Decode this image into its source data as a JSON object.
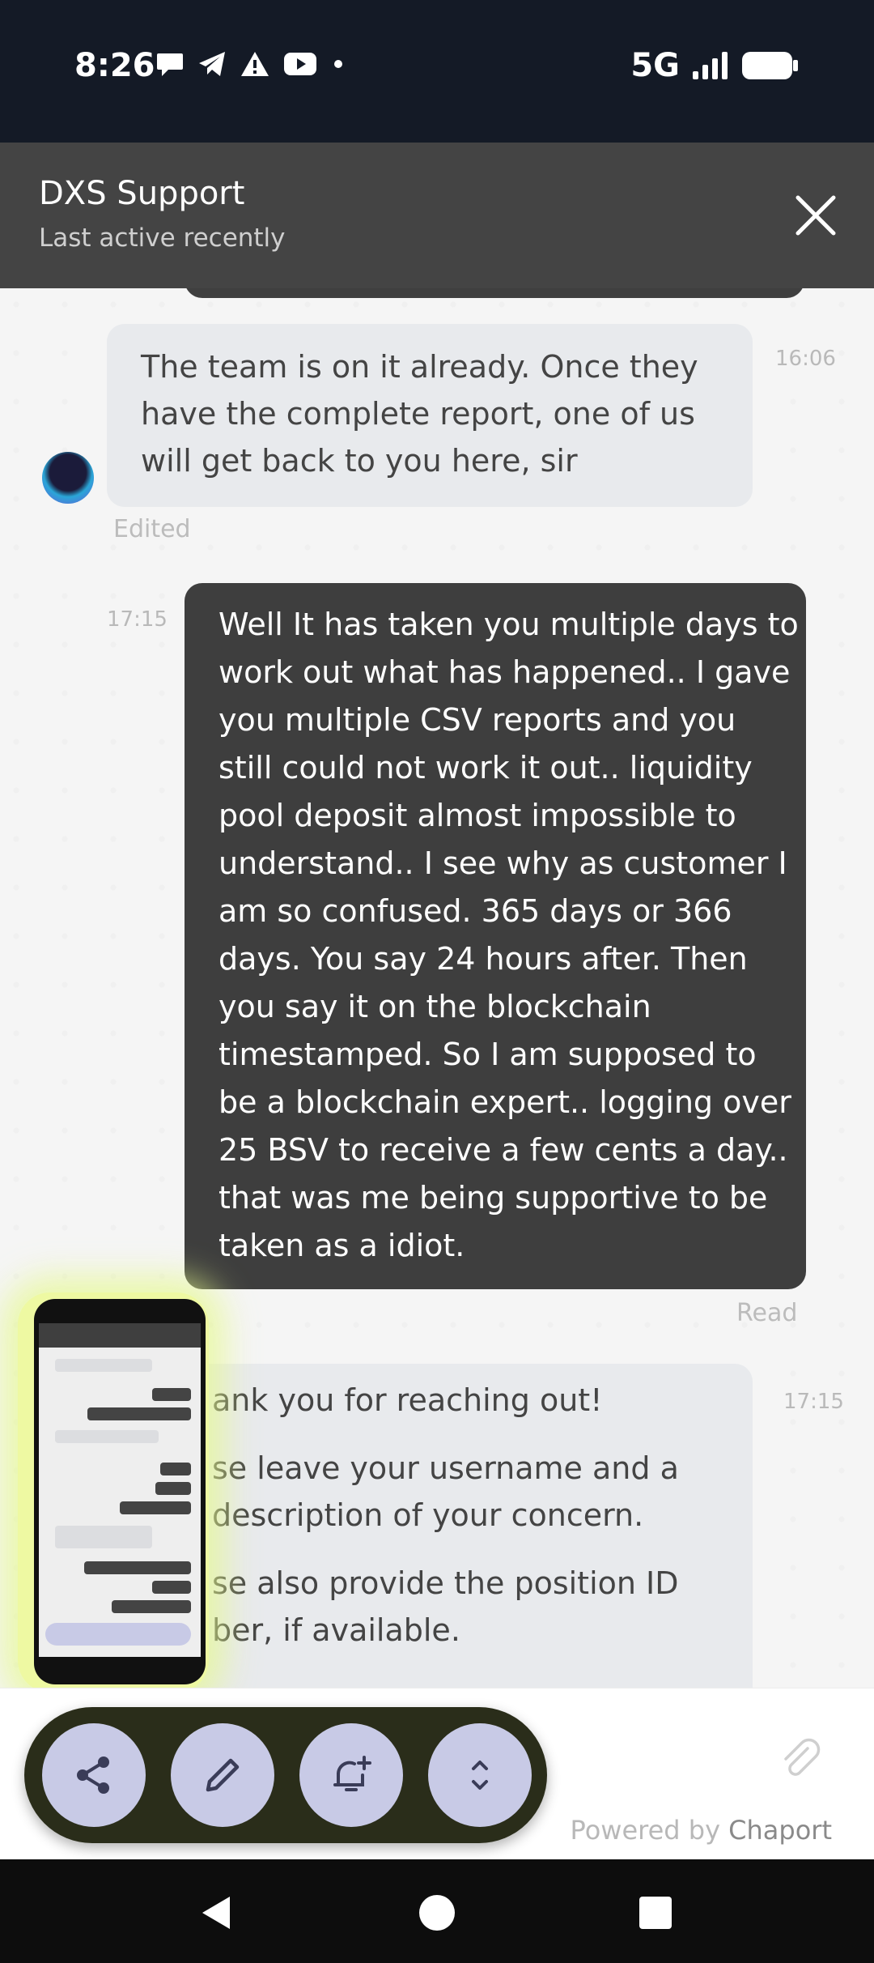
{
  "status_bar": {
    "time": "8:26",
    "network": "5G",
    "notification_icons": [
      "chat-bubble-icon",
      "telegram-icon",
      "warning-icon",
      "youtube-icon",
      "dot-icon"
    ]
  },
  "header": {
    "title": "DXS Support",
    "subtitle": "Last active recently"
  },
  "messages": [
    {
      "from": "agent",
      "text_lines": [
        "The team is on it already. Once they",
        "have the complete report, one of us",
        "will get back to you here, sir"
      ],
      "time": "16:06",
      "meta": "Edited"
    },
    {
      "from": "user",
      "text_lines": [
        "Well It has taken you multiple days to",
        "work out what has happened.. I gave",
        "you multiple CSV reports and you",
        "still could not work it out.. liquidity",
        "pool deposit almost impossible to",
        "understand.. I see why as customer I",
        "am so confused. 365 days or 366",
        "days. You say 24 hours after. Then",
        "you say it on the blockchain",
        "timestamped. So I am supposed to",
        "be a blockchain expert.. logging over",
        "25 BSV to receive a few cents a day..",
        "that was me being supportive to be",
        "taken as a idiot."
      ],
      "time": "17:15",
      "meta": "Read"
    },
    {
      "from": "agent",
      "text_lines": [
        "ank you for reaching out!",
        "se leave your username and a",
        "description of your concern.",
        "se also provide the position ID",
        "ber, if available."
      ],
      "time": "17:15"
    }
  ],
  "footer": {
    "powered_prefix": "Powered by",
    "powered_brand": "Chaport"
  },
  "toolbar": {
    "buttons": [
      "share-icon",
      "pencil-icon",
      "bell-plus-icon",
      "expand-icon"
    ]
  },
  "colors": {
    "header_bg": "#444444",
    "user_bubble": "#3e3e3e",
    "agent_bubble": "#e8eaed",
    "toolbar_bg": "#2a2d1a",
    "toolbar_button": "#c8cae6",
    "thumbnail_glow": "#eef9a2"
  }
}
